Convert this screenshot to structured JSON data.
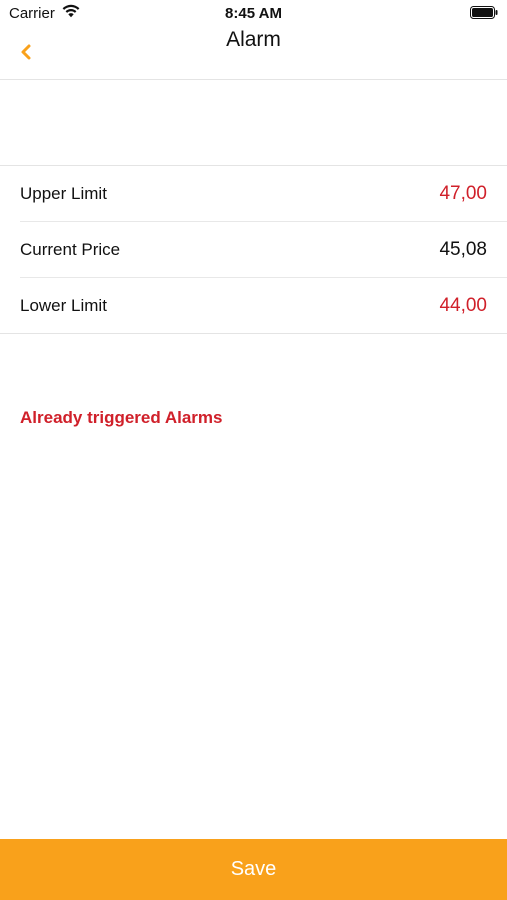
{
  "status_bar": {
    "carrier": "Carrier",
    "time": "8:45 AM",
    "icons": [
      "wifi-icon",
      "battery-icon"
    ]
  },
  "nav": {
    "title": "Alarm",
    "back_icon": "chevron-left-icon",
    "accent_color": "#f9a11b"
  },
  "limits": {
    "upper": {
      "label": "Upper Limit",
      "value": "47,00",
      "color": "#d0202a"
    },
    "current": {
      "label": "Current Price",
      "value": "45,08",
      "color": "#111111"
    },
    "lower": {
      "label": "Lower Limit",
      "value": "44,00",
      "color": "#d0202a"
    }
  },
  "triggered": {
    "label": "Already triggered Alarms",
    "color": "#d0202a"
  },
  "footer": {
    "save_label": "Save",
    "color": "#f9a11b"
  }
}
